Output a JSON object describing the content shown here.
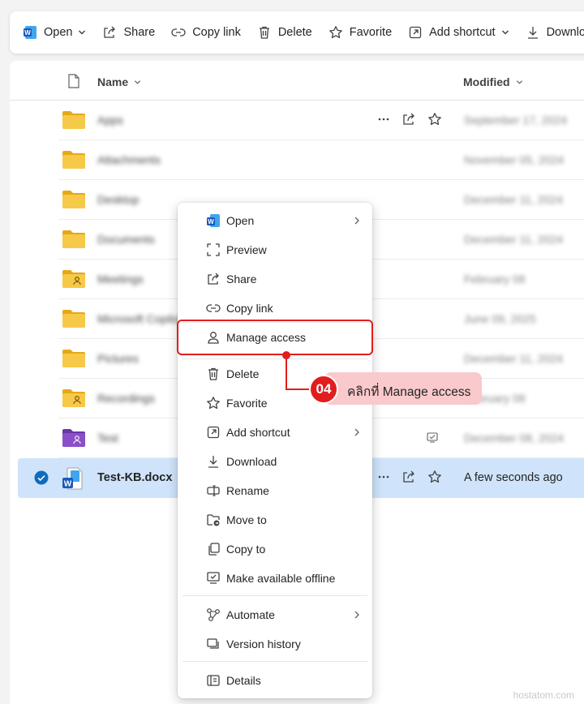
{
  "toolbar": {
    "open_label": "Open",
    "share_label": "Share",
    "copy_link_label": "Copy link",
    "delete_label": "Delete",
    "favorite_label": "Favorite",
    "add_shortcut_label": "Add shortcut",
    "download_label": "Download"
  },
  "list": {
    "name_header": "Name",
    "modified_header": "Modified",
    "rows": [
      {
        "name": "Apps",
        "modified": "September 17, 2024"
      },
      {
        "name": "Attachments",
        "modified": "November 05, 2024"
      },
      {
        "name": "Desktop",
        "modified": "December 11, 2024"
      },
      {
        "name": "Documents",
        "modified": "December 11, 2024"
      },
      {
        "name": "Meetings",
        "modified": "February 08"
      },
      {
        "name": "Microsoft Copilot",
        "modified": "June 09, 2025"
      },
      {
        "name": "Pictures",
        "modified": "December 11, 2024"
      },
      {
        "name": "Recordings",
        "modified": "February 08"
      },
      {
        "name": "Test",
        "modified": "December 08, 2024"
      }
    ],
    "selected_row": {
      "name": "Test-KB.docx",
      "modified": "A few seconds ago"
    }
  },
  "context_menu": {
    "items": [
      {
        "label": "Open"
      },
      {
        "label": "Preview"
      },
      {
        "label": "Share"
      },
      {
        "label": "Copy link"
      },
      {
        "label": "Manage access"
      },
      {
        "label": "Delete"
      },
      {
        "label": "Favorite"
      },
      {
        "label": "Add shortcut"
      },
      {
        "label": "Download"
      },
      {
        "label": "Rename"
      },
      {
        "label": "Move to"
      },
      {
        "label": "Copy to"
      },
      {
        "label": "Make available offline"
      },
      {
        "label": "Automate"
      },
      {
        "label": "Version history"
      },
      {
        "label": "Details"
      }
    ]
  },
  "callout": {
    "step": "04",
    "text": "คลิกที่ Manage access",
    "color": "#e11d1d"
  },
  "watermark": "hostatom.com",
  "colors": {
    "selected_row": "#cfe4fa",
    "check": "#0f6cbd",
    "folder": "#f7c948",
    "folder_purple": "#8a4fc9"
  }
}
